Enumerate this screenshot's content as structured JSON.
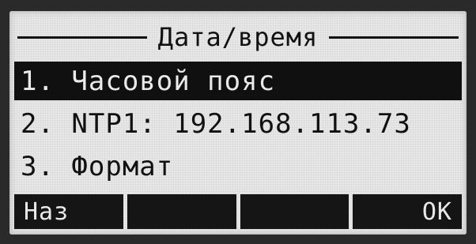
{
  "screen": {
    "title": "Дата/время"
  },
  "menu": {
    "items": [
      {
        "label": "1. Часовой пояс",
        "selected": true
      },
      {
        "label": "2. NTP1: 192.168.113.73",
        "selected": false
      },
      {
        "label": "3. Формат",
        "selected": false
      }
    ]
  },
  "softkeys": {
    "back_label": "Наз",
    "key2_label": "",
    "key3_label": "",
    "ok_label": "OK"
  },
  "colors": {
    "lcd_background": "#e8e8e8",
    "highlight": "#101010",
    "text": "#111111"
  }
}
